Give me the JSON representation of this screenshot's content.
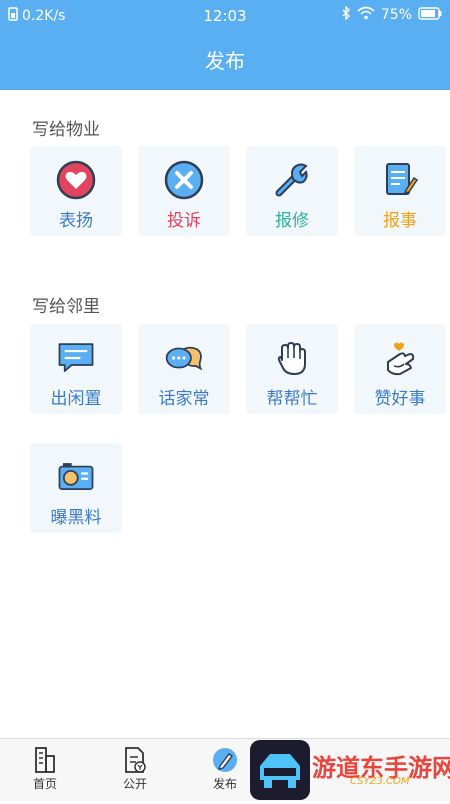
{
  "statusbar": {
    "speed": "0.2K/s",
    "time": "12:03",
    "battery": "75%"
  },
  "appbar": {
    "title": "发布"
  },
  "sections": [
    {
      "title": "写给物业",
      "items": [
        {
          "label": "表扬",
          "color": "#3a7bc8",
          "icon": "heart-icon"
        },
        {
          "label": "投诉",
          "color": "#e0445f",
          "icon": "close-circle-icon"
        },
        {
          "label": "报修",
          "color": "#2bb3a3",
          "icon": "wrench-icon"
        },
        {
          "label": "报事",
          "color": "#f0a21b",
          "icon": "notepad-icon"
        }
      ]
    },
    {
      "title": "写给邻里",
      "items": [
        {
          "label": "出闲置",
          "color": "#3a7bc8",
          "icon": "chat-bubble-icon"
        },
        {
          "label": "话家常",
          "color": "#3a7bc8",
          "icon": "chat-bubbles-icon"
        },
        {
          "label": "帮帮忙",
          "color": "#3a7bc8",
          "icon": "raised-hand-icon"
        },
        {
          "label": "赞好事",
          "color": "#3a7bc8",
          "icon": "heart-hand-icon"
        },
        {
          "label": "曝黑料",
          "color": "#3a7bc8",
          "icon": "camera-icon"
        }
      ]
    }
  ],
  "tabbar": [
    {
      "label": "首页",
      "icon": "building-icon"
    },
    {
      "label": "公开",
      "icon": "document-icon"
    },
    {
      "label": "发布",
      "icon": "pen-icon"
    }
  ],
  "watermark": {
    "text": "游道东手游网",
    "url": "CSYZ3.COM"
  }
}
